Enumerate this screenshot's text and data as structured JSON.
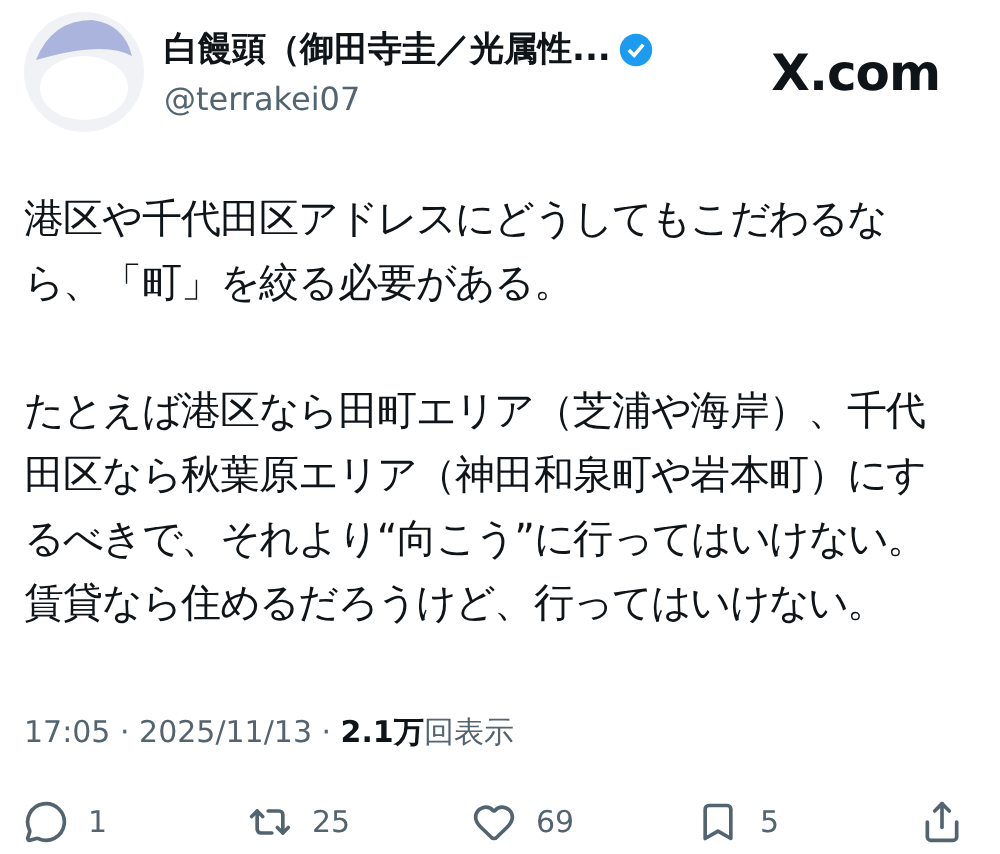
{
  "author": {
    "name": "白饅頭（御田寺圭／光属性...",
    "handle": "@terrakei07",
    "verified": true
  },
  "site": "X.com",
  "paragraphs": [
    {
      "lines": [
        "港区や千代田区アドレスにどうしてもこだわるな",
        "ら、「町」を絞る必要がある。"
      ]
    },
    {
      "lines": [
        "たとえば港区なら田町エリア（芝浦や海岸）、千代",
        "田区なら秋葉原エリア（神田和泉町や岩本町）にす",
        "るべきで、それより“向こう”に行ってはいけない。",
        "賃貸なら住めるだろうけど、行ってはいけない。"
      ]
    }
  ],
  "meta": "17:05 · 2025/11/13 · **2.1万**回表示",
  "actions": [
    {
      "kind": "reply",
      "count": "1"
    },
    {
      "kind": "repost",
      "count": "25"
    },
    {
      "kind": "like",
      "count": "69"
    },
    {
      "kind": "bookmark",
      "count": "5"
    },
    {
      "kind": "share"
    }
  ]
}
